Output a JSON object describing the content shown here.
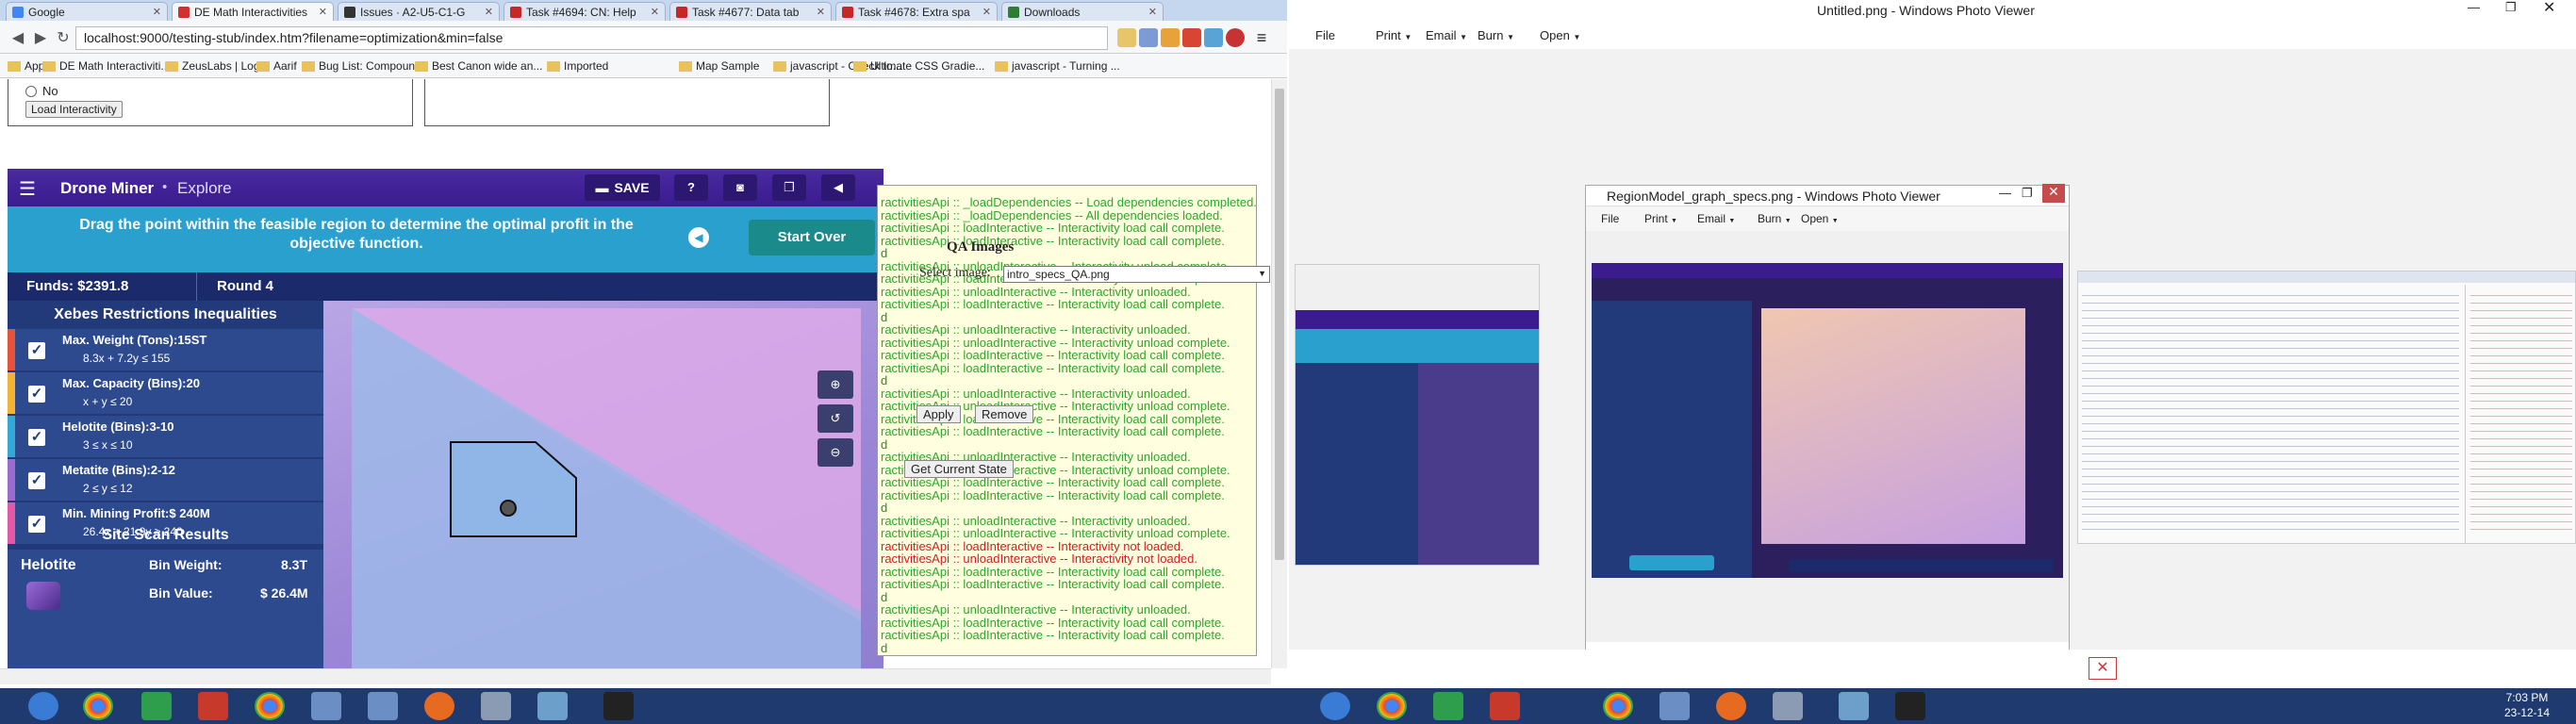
{
  "browser": {
    "tabs": [
      {
        "label": "Google",
        "color": "#4285f4"
      },
      {
        "label": "DE Math Interactivities",
        "color": "#d32f2f"
      },
      {
        "label": "Issues · A2-U5-C1-G",
        "color": "#333333"
      },
      {
        "label": "Task #4694: CN: Help",
        "color": "#c62828"
      },
      {
        "label": "Task #4677: Data tab",
        "color": "#c62828"
      },
      {
        "label": "Task #4678: Extra spa",
        "color": "#c62828"
      },
      {
        "label": "Downloads",
        "color": "#2e7d32"
      }
    ],
    "url": "localhost:9000/testing-stub/index.htm?filename=optimization&min=false",
    "bookmarks": [
      "Apps",
      "DE Math Interactiviti...",
      "ZeusLabs | Login",
      "Aarif",
      "Bug List: Compoun...",
      "Best Canon wide an...",
      "Imported",
      "Map Sample",
      "javascript - Check to...",
      "Ultimate CSS Gradie...",
      "javascript - Turning ..."
    ]
  },
  "page": {
    "no_label": "No",
    "load_button": "Load Interactivity",
    "drone": {
      "menu_icon": "menu-icon",
      "title": "Drone Miner",
      "mode": "Explore",
      "save_label": "SAVE",
      "instruction": "Drag the point within the feasible region to determine the optimal profit in the objective function.",
      "start_over": "Start Over",
      "funds": "Funds: $2391.8",
      "round": "Round 4",
      "constraints_title": "Xebes Restrictions Inequalities",
      "constraints": [
        {
          "name": "Max. Weight (Tons):",
          "value": "15ST",
          "expr": "8.3x + 7.2y ≤ 155",
          "stripe": "#e5533a"
        },
        {
          "name": "Max. Capacity (Bins):",
          "value": "20",
          "expr": "x + y ≤ 20",
          "stripe": "#f4b433"
        },
        {
          "name": "Helotite (Bins):",
          "value": "3-10",
          "expr": "3 ≤ x ≤ 10",
          "stripe": "#36a8d8"
        },
        {
          "name": "Metatite (Bins):",
          "value": "2-12",
          "expr": "2 ≤ y ≤ 12",
          "stripe": "#9c6bd0"
        },
        {
          "name": "Min. Mining Profit:",
          "value": "$ 240M",
          "expr": "26.4x + 21.9y ≥ 240",
          "stripe": "#e05aa8"
        }
      ],
      "site_title": "Site Scan Results",
      "site_name": "Helotite",
      "bin_weight_label": "Bin Weight:",
      "bin_weight_value": "8.3T",
      "bin_value_label": "Bin Value:",
      "bin_value_value": "$ 26.4M"
    },
    "debug": {
      "qa_title": "QA Images",
      "select_label": "Select image:",
      "select_value": "intro_specs_QA.png",
      "apply": "Apply",
      "remove": "Remove",
      "get_state": "Get Current State",
      "lines": [
        "ractivitiesApi :: _loadDependencies -- Load dependencies completed.",
        "ractivitiesApi :: _loadDependencies -- All dependencies loaded.",
        "ractivitiesApi :: loadInteractive -- Interactivity load call complete.",
        "ractivitiesApi :: loadInteractive -- Interactivity load call complete.",
        "d",
        "ractivitiesApi :: unloadInteractive -- Interactivity unload complete.",
        "ractivitiesApi :: loadInteractive -- Interactivity load call complete.",
        "ractivitiesApi :: unloadInteractive -- Interactivity unloaded.",
        "ractivitiesApi :: loadInteractive -- Interactivity load call complete.",
        "d",
        "ractivitiesApi :: unloadInteractive -- Interactivity unloaded.",
        "ractivitiesApi :: unloadInteractive -- Interactivity unload complete.",
        "ractivitiesApi :: loadInteractive -- Interactivity load call complete.",
        "ractivitiesApi :: loadInteractive -- Interactivity load call complete.",
        "d",
        "ractivitiesApi :: unloadInteractive -- Interactivity unloaded.",
        "ractivitiesApi :: unloadInteractive -- Interactivity unload complete.",
        "ractivitiesApi :: loadInteractive -- Interactivity load call complete.",
        "ractivitiesApi :: loadInteractive -- Interactivity load call complete.",
        "d",
        "ractivitiesApi :: unloadInteractive -- Interactivity unloaded.",
        "ractivitiesApi :: unloadInteractive -- Interactivity unload complete.",
        "ractivitiesApi :: loadInteractive -- Interactivity load call complete.",
        "ractivitiesApi :: loadInteractive -- Interactivity load call complete.",
        "d",
        "ractivitiesApi :: unloadInteractive -- Interactivity unloaded.",
        "ractivitiesApi :: unloadInteractive -- Interactivity unload complete.",
        "ractivitiesApi :: loadInteractive -- Interactivity not loaded.",
        "ractivitiesApi :: unloadInteractive -- Interactivity not loaded.",
        "ractivitiesApi :: loadInteractive -- Interactivity load call complete.",
        "ractivitiesApi :: loadInteractive -- Interactivity load call complete.",
        "d",
        "ractivitiesApi :: unloadInteractive -- Interactivity unloaded.",
        "ractivitiesApi :: loadInteractive -- Interactivity load call complete.",
        "ractivitiesApi :: loadInteractive -- Interactivity load call complete.",
        "d"
      ]
    }
  },
  "photo_viewer": {
    "title": "Untitled.png - Windows Photo Viewer",
    "menu": [
      "File",
      "Print",
      "Email",
      "Burn",
      "Open"
    ],
    "inner_title": "RegionModel_graph_specs.png - Windows Photo Viewer",
    "inner_menu": [
      "File",
      "Print",
      "Email",
      "Burn",
      "Open"
    ]
  },
  "taskbar": {
    "time": "7:03 PM",
    "date": "23-12-14"
  }
}
